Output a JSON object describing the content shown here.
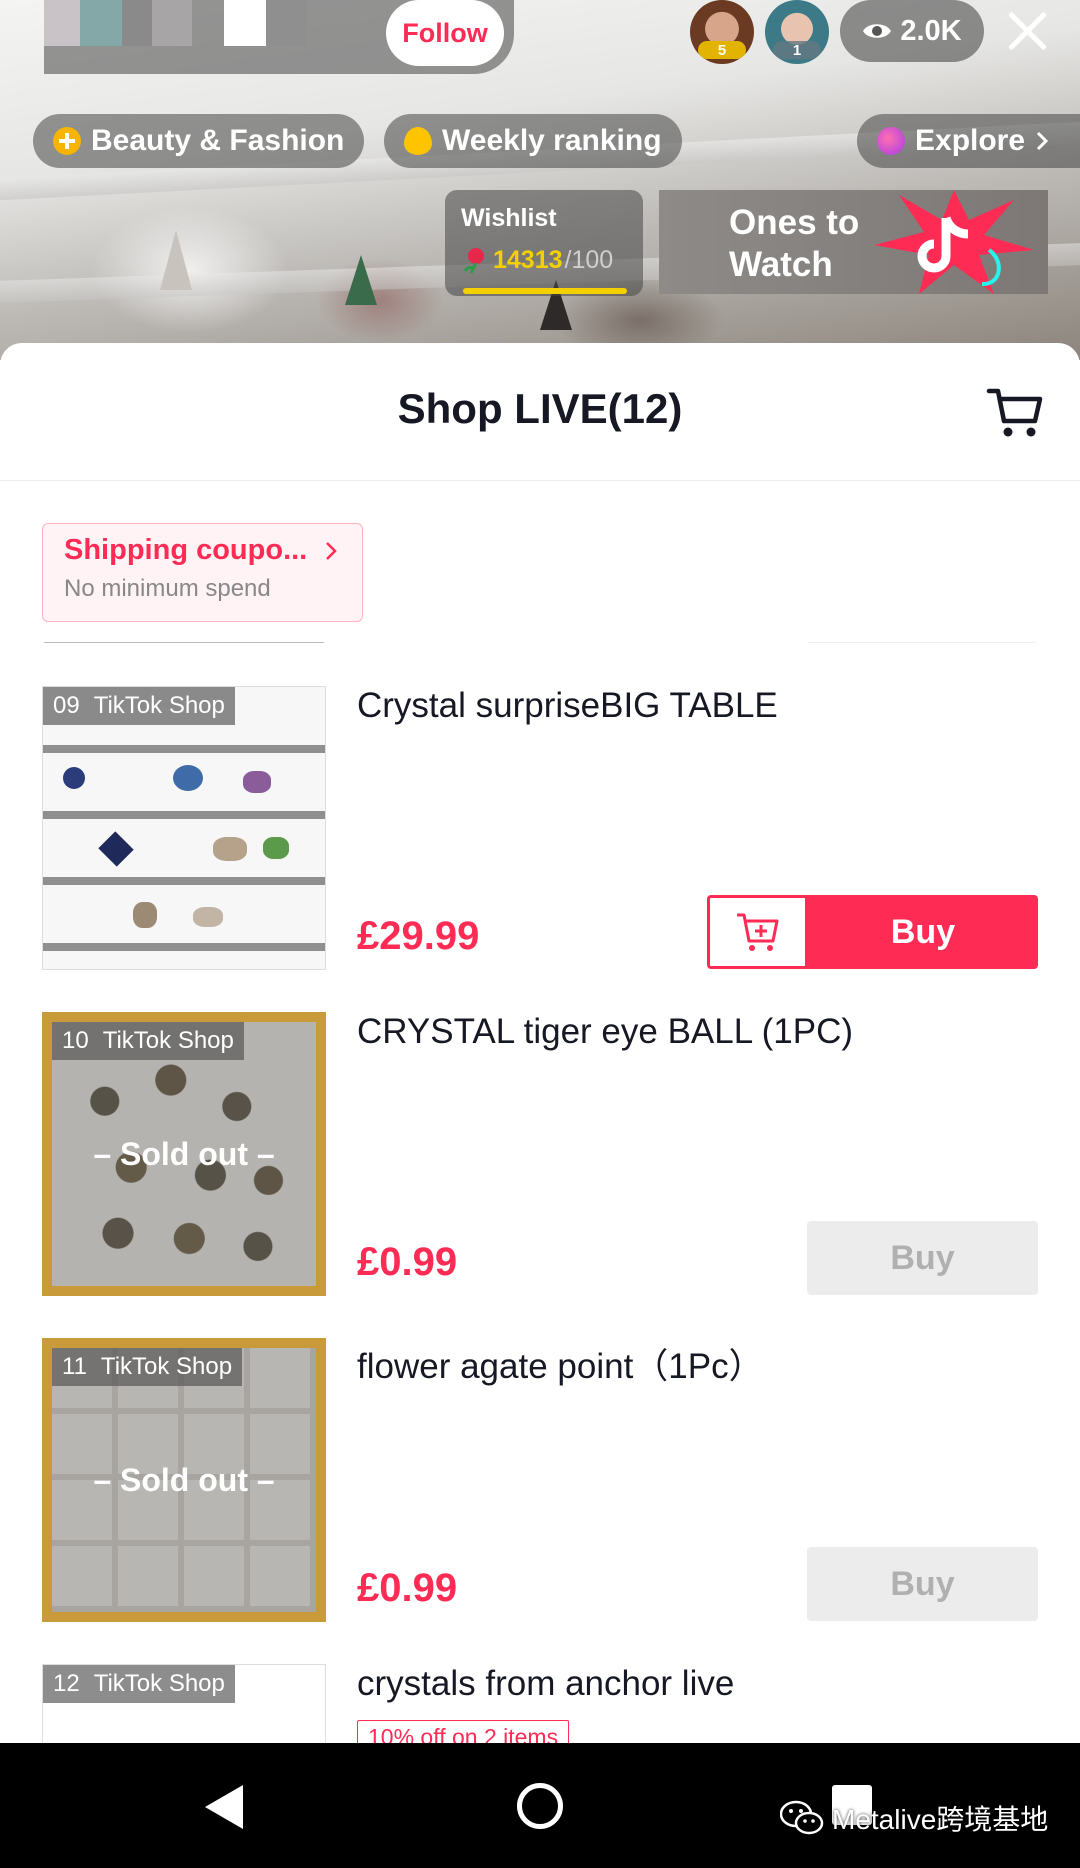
{
  "top_bar": {
    "follow_label": "Follow",
    "viewer1_rank": "5",
    "viewer2_rank": "1",
    "viewer_count": "2.0K"
  },
  "tags": {
    "category": "Beauty & Fashion",
    "ranking": "Weekly ranking",
    "explore": "Explore"
  },
  "wishlist": {
    "title": "Wishlist",
    "count": "14313",
    "goal": "/100"
  },
  "ones_to_watch": "Ones to\nWatch",
  "sheet": {
    "title": "Shop LIVE(12)"
  },
  "coupon": {
    "title": "Shipping coupo...",
    "subtitle": "No minimum spend"
  },
  "products": [
    {
      "index": "09",
      "shop": "TikTok Shop",
      "name": "Crystal surpriseBIG TABLE",
      "price": "£29.99",
      "buy": "Buy",
      "sold_out": false
    },
    {
      "index": "10",
      "shop": "TikTok Shop",
      "name": "CRYSTAL tiger eye BALL (1PC)",
      "price": "£0.99",
      "buy": "Buy",
      "sold_out": true,
      "sold_out_label": "– Sold out –"
    },
    {
      "index": "11",
      "shop": "TikTok Shop",
      "name": "flower agate point（1Pc）",
      "price": "£0.99",
      "buy": "Buy",
      "sold_out": true,
      "sold_out_label": "– Sold out –"
    },
    {
      "index": "12",
      "shop": "TikTok Shop",
      "name": "crystals from anchor  live",
      "discount": "10% off on 2 items"
    }
  ],
  "watermark": "Metalive跨境基地",
  "colors": {
    "accent": "#fe2c55",
    "sold_out_button": "#ececec",
    "wishlist_count": "#f5d000"
  },
  "icons": {
    "viewers": "eye-icon",
    "close": "close-icon",
    "cart": "shopping-cart-icon",
    "add_to_cart": "add-to-cart-icon",
    "back": "back-triangle-icon",
    "home": "home-circle-icon",
    "recents": "recents-square-icon"
  }
}
